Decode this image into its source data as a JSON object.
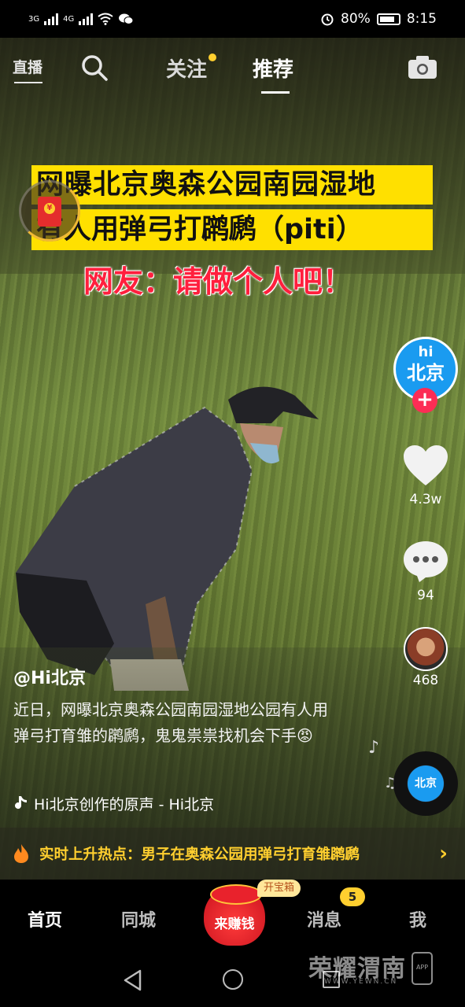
{
  "status_bar": {
    "network1": "3G",
    "network2": "4G",
    "battery": "80%",
    "time": "8:15"
  },
  "top_nav": {
    "live_label": "直播",
    "follow_tab": "关注",
    "recommend_tab": "推荐"
  },
  "video": {
    "headline1": "网曝北京奥森公园南园湿地",
    "headline2": "有人用弹弓打䴙䴘（piti）",
    "headline3": "网友：请做个人吧！"
  },
  "envelope": {
    "symbol": "¥"
  },
  "side": {
    "avatar_hi": "hi",
    "avatar_bj": "北京",
    "follow_plus": "+",
    "like_count": "4.3w",
    "comment_count": "94",
    "share_count": "468"
  },
  "caption": {
    "user": "@Hi北京",
    "text": "近日，网曝北京奥森公园南园湿地公园有人用弹弓打育雏的䴙䴘，鬼鬼祟祟找机会下手😡",
    "music": "Hi北京创作的原声 - Hi北京"
  },
  "disc": {
    "label": "北京"
  },
  "hot_topic": {
    "text": "实时上升热点：男子在奥森公园用弹弓打育雏䴙䴘",
    "arrow": "›"
  },
  "bottom_nav": {
    "home": "首页",
    "city": "同城",
    "earn": "来赚钱",
    "treasure": "开宝箱",
    "messages": "消息",
    "messages_badge": "5",
    "me": "我"
  },
  "watermark": {
    "name": "荣耀渭南",
    "url": "WWW.YEWN.CN",
    "app": "APP"
  },
  "colors": {
    "accent_yellow": "#ffcf2f",
    "banner_yellow": "#ffe000",
    "headline_red": "#ff1f3d",
    "follow_pink": "#fc2c55",
    "avatar_blue": "#1a9bf0"
  }
}
